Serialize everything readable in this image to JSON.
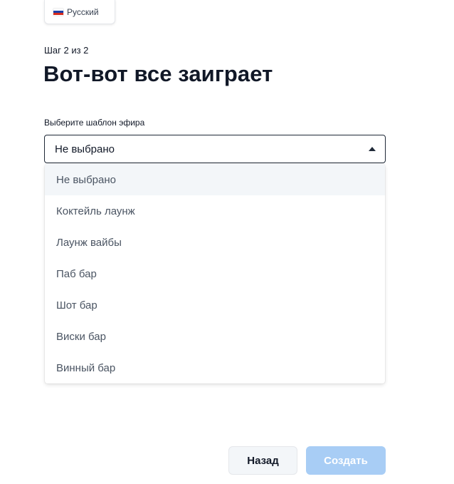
{
  "language": {
    "label": "Русский",
    "flag_colors": [
      "#ffffff",
      "#1c3fa8",
      "#d52b1e"
    ]
  },
  "step": "Шаг 2 из 2",
  "title": "Вот-вот все заиграет",
  "template_field": {
    "label": "Выберите шаблон эфира",
    "value": "Не выбрано",
    "options": [
      "Не выбрано",
      "Коктейль лаунж",
      "Лаунж вайбы",
      "Паб бар",
      "Шот бар",
      "Виски бар",
      "Винный бар"
    ]
  },
  "buttons": {
    "back": "Назад",
    "create": "Создать"
  },
  "colors": {
    "primary_disabled": "#a8cdf5",
    "text": "#111827",
    "selected_option_bg": "#f3f6f9"
  }
}
